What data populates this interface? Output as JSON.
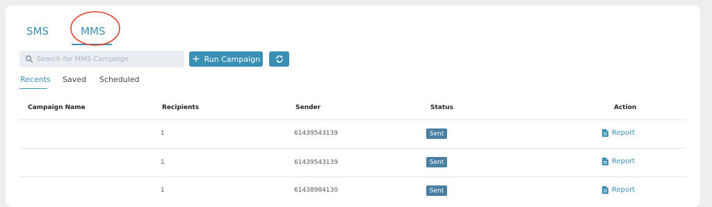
{
  "tabs": {
    "sms": "SMS",
    "mms": "MMS"
  },
  "search": {
    "placeholder": "Search for MMS Campaign",
    "value": ""
  },
  "run_campaign": {
    "label": "Run Campaign"
  },
  "subtabs": {
    "recents": "Recents",
    "saved": "Saved",
    "scheduled": "Scheduled"
  },
  "table": {
    "headers": [
      "Campaign Name",
      "Recipients",
      "Sender",
      "Status",
      "Action"
    ],
    "rows": [
      {
        "campaign_name": "",
        "recipients": "1",
        "sender": "61439543139",
        "status": "Sent",
        "action": "Report"
      },
      {
        "campaign_name": "",
        "recipients": "1",
        "sender": "61439543139",
        "status": "Sent",
        "action": "Report"
      },
      {
        "campaign_name": "",
        "recipients": "1",
        "sender": "61438984130",
        "status": "Sent",
        "action": "Report"
      }
    ]
  },
  "colors": {
    "accent": "#3a8fb5",
    "badge": "#4a7fa3",
    "annotation": "#e0412b"
  },
  "icons": {
    "search": "search-icon",
    "plus": "plus-icon",
    "refresh": "refresh-icon",
    "report": "document-icon"
  }
}
